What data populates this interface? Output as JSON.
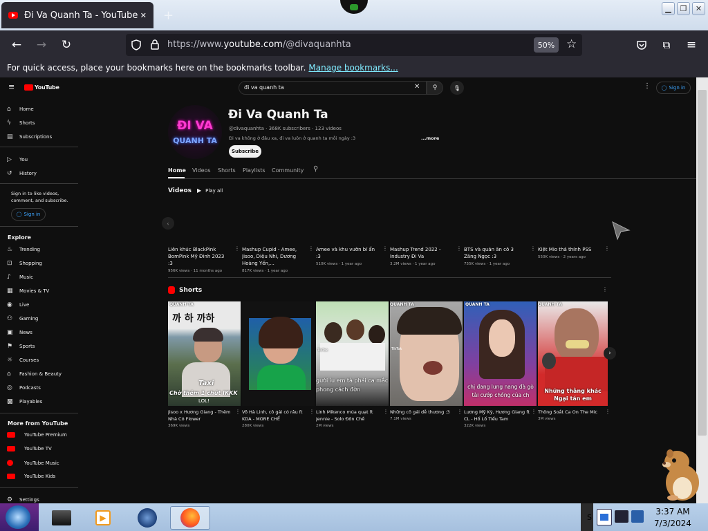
{
  "browser": {
    "tab_title": "Đi Va Quanh Ta - YouTube",
    "tab_close": "✕",
    "new_tab": "+",
    "url_prefix": "https://www.",
    "url_domain": "youtube.com",
    "url_path": "/@divaquanhta",
    "zoom": "50%",
    "bookmarks_message": "For quick access, place your bookmarks here on the bookmarks toolbar.",
    "bookmarks_link": "Manage bookmarks..."
  },
  "yt": {
    "logo": "YouTube",
    "search_value": "đi va quanh ta",
    "sign_in": "Sign in",
    "sidebar": {
      "main": [
        "Home",
        "Shorts",
        "Subscriptions"
      ],
      "you": [
        "You",
        "History"
      ],
      "signin_prompt": "Sign in to like videos, comment, and subscribe.",
      "signin_button": "Sign in",
      "explore_header": "Explore",
      "explore": [
        "Trending",
        "Shopping",
        "Music",
        "Movies & TV",
        "Live",
        "Gaming",
        "News",
        "Sports",
        "Courses",
        "Fashion & Beauty",
        "Podcasts",
        "Playables"
      ],
      "more_header": "More from YouTube",
      "more": [
        "YouTube Premium",
        "YouTube TV",
        "YouTube Music",
        "YouTube Kids"
      ],
      "settings": "Settings"
    },
    "channel": {
      "avatar_line1": "ĐI VA",
      "avatar_line2": "QUANH TA",
      "name": "Đi Va Quanh Ta",
      "handle_stats": "@divaquanhta · 368K subscribers · 123 videos",
      "description": "Đi va không ở đâu xa, đi va luôn ở quanh ta mỗi ngày :3",
      "more": "...more",
      "subscribe": "Subscribe",
      "tabs": [
        "Home",
        "Videos",
        "Shorts",
        "Playlists",
        "Community"
      ],
      "active_tab": "Home"
    },
    "videos_section": {
      "title": "Videos",
      "play_all": "Play all",
      "items": [
        {
          "title": "Liên khúc BlackPink BomPink Mỹ Đình 2023 :3",
          "meta": "956K views · 11 months ago"
        },
        {
          "title": "Mashup Cupid - Amee, Jisoo, Diệu Nhi, Dương Hoàng Yến,...",
          "meta": "817K views · 1 year ago"
        },
        {
          "title": "Amee và khu vườn bí ẩn :3",
          "meta": "510K views · 1 year ago"
        },
        {
          "title": "Mashup Trend 2022 - Industry Đi Va",
          "meta": "3.2M views · 1 year ago"
        },
        {
          "title": "BTS và quán ăn cô 3 Zăng Ngọc :3",
          "meta": "755K views · 1 year ago"
        },
        {
          "title": "Kiệt Mio thả thính PSS",
          "meta": "550K views · 2 years ago"
        }
      ]
    },
    "shorts_section": {
      "title": "Shorts",
      "items": [
        {
          "title": "Jisoo x Hương Giang - Thêm Nhà Có Flower",
          "meta": "369K views",
          "caption": "Chờ thêm 1 chút IKKK",
          "watermark": "QUANH TA",
          "top_text": "까 하 까하",
          "extra": "Taxi",
          "extra2": "LOL!"
        },
        {
          "title": "Võ Hà Linh, cô gái có râu ft KDA - MORE CHẾ",
          "meta": "280K views",
          "caption": "",
          "watermark": "",
          "top_text": "",
          "extra": "",
          "extra2": ""
        },
        {
          "title": "Linh Mikenco múa quạt ft Jennie - Solo Đôn Chề",
          "meta": "2M views",
          "caption": "gười íu em tà phải ca mắc phong cách đờn",
          "watermark": "",
          "top_text": "",
          "extra": "TikTok",
          "extra2": ""
        },
        {
          "title": "Những cô gái dễ thương :3",
          "meta": "7.1M views",
          "caption": "",
          "watermark": "QUANH TA",
          "top_text": "",
          "extra": "TikTok",
          "extra2": ""
        },
        {
          "title": "Lương Mỹ Kỳ, Hương Giang ft CL - Hổ Lố Tiểu Tam",
          "meta": "322K views",
          "caption": "chị đang lung nang đà gò tài cướp chồng của ch",
          "watermark": "QUANH TA",
          "top_text": "",
          "extra": "",
          "extra2": ""
        },
        {
          "title": "Thông Soắt Ca On The Mic",
          "meta": "3M views",
          "caption": "Những thằng khác Ngại tán em",
          "watermark": "QUANH TA",
          "top_text": "",
          "extra": "",
          "extra2": ""
        }
      ]
    }
  },
  "taskbar": {
    "time": "3:37 AM",
    "date": "7/3/2024",
    "tray_letter": "S"
  },
  "colors": {
    "youtube_red": "#ff0000",
    "link_blue": "#3ea6ff",
    "page_bg": "#0f0f0f"
  }
}
